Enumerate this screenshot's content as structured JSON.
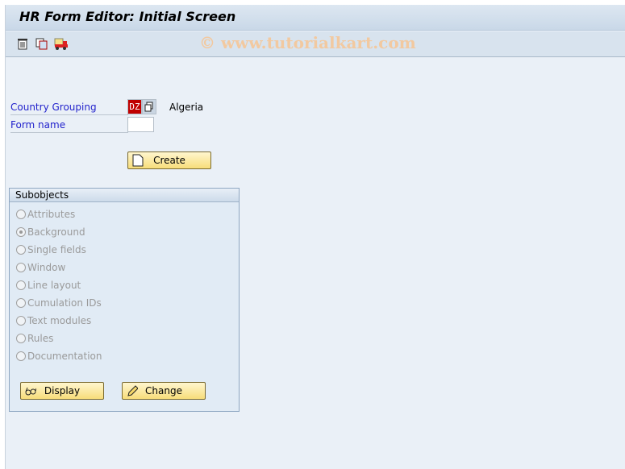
{
  "title": "HR Form Editor: Initial Screen",
  "toolbar": {
    "icons": [
      "delete-icon",
      "copy-icon",
      "transport-icon"
    ]
  },
  "watermark": "© www.tutorialkart.com",
  "form": {
    "country_grouping_label": "Country Grouping",
    "country_grouping_value": "DZ",
    "country_name": "Algeria",
    "form_name_label": "Form name",
    "form_name_value": "",
    "create_label": "Create"
  },
  "subobjects": {
    "title": "Subobjects",
    "options": [
      "Attributes",
      "Background",
      "Single fields",
      "Window",
      "Line layout",
      "Cumulation IDs",
      "Text modules",
      "Rules",
      "Documentation"
    ],
    "selected": "Background",
    "display_label": "Display",
    "change_label": "Change"
  }
}
